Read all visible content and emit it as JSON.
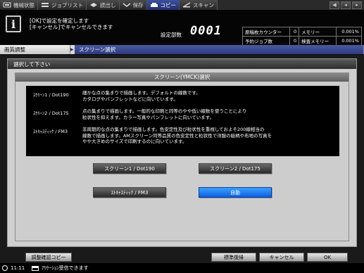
{
  "tabs": [
    {
      "label": "機械状態",
      "icon": "machine-icon"
    },
    {
      "label": "ジョブリスト",
      "icon": "job-list-icon"
    },
    {
      "label": "読出し",
      "icon": "recall-icon"
    },
    {
      "label": "保存",
      "icon": "store-icon"
    },
    {
      "label": "コピー",
      "icon": "copy-icon",
      "active": true
    },
    {
      "label": "スキャン",
      "icon": "scan-icon"
    }
  ],
  "message": {
    "line1": "[OK]で設定を確定します",
    "line2": "[キャンセル]でキャンセルできます"
  },
  "copies": {
    "label": "設定部数",
    "value": "0001"
  },
  "status": [
    {
      "label": "原稿枚カウンター",
      "value": "0",
      "label2": "メモリー",
      "value2": "0.001%"
    },
    {
      "label": "予約ジョブ数",
      "value": "0",
      "label2": "検査メモリー",
      "value2": "0.001%"
    }
  ],
  "breadcrumb": {
    "parent": "画質調整",
    "current": "スクリーン選択"
  },
  "panel": {
    "prompt": "選択して下さい",
    "title": "スクリーン(YMCK)選択",
    "descriptions": [
      {
        "name": "ｽｸﾘｰﾝ1 / Dot190",
        "text": "細かな点の集まりで描画します。デフォルトの線数です。\nカタログやパンフレットなどに向いています。"
      },
      {
        "name": "ｽｸﾘｰﾝ2 / Dot175",
        "text": "点の集まりで描画します。一般的な印刷と同等のやや低い線数を使うことにより\n粒状性を抑えます。カラー写真やパンフレットに向いています。"
      },
      {
        "name": "ｽﾄｷｬｽﾃｨｯｸ / FM3",
        "text": "非周期的な点の集まりで描画します。色安定性及び粒状性を重視しておよそ200線相当の\n線数で描画します。AMスクリーン同等品質の色安定性と粒状性で洋服の絵柄や布地の写真を\nやや大きめのサイズで印刷するのに向いています。"
      }
    ],
    "options": [
      {
        "label": "スクリーン1 / Dot190",
        "selected": false
      },
      {
        "label": "スクリーン2 / Dot175",
        "selected": false
      },
      {
        "label": "ｽﾄｷｬｽﾃｨｯｸ / FM3",
        "selected": false
      },
      {
        "label": "自動",
        "selected": true
      }
    ]
  },
  "bottom": {
    "proof_copy": "調整確認コピー",
    "default": "標準復帰",
    "cancel": "キャンセル",
    "ok": "OK"
  },
  "footer": {
    "time": "11:11",
    "status": "ｱﾘｹｰｼｮﾝ受信できます"
  }
}
